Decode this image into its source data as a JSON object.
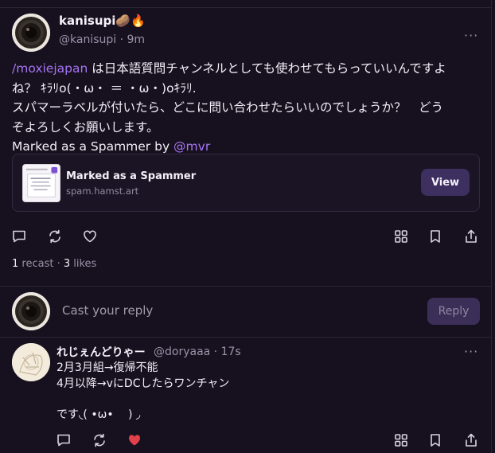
{
  "post": {
    "author_name": "kanisupi🥔🔥",
    "author_handle": "@kanisupi · 9m",
    "more_label": "···",
    "channel_mention": "/moxiejapan",
    "body_line1_rest": " は日本語質問チャンネルとしても使わせてもらっていいんですよ",
    "body_line2": "ね？ ｷﾗﾘo(・ω・ ＝ ・ω・)oｷﾗﾘ.",
    "body_line3": "スパマーラベルが付いたら、どこに問い合わせたらいいのでしょうか？　どう",
    "body_line4": "ぞよろしくお願いします。",
    "body_line5_prefix": "Marked as a Spammer by ",
    "body_line5_mention": "@mvr",
    "embed": {
      "title": "Marked as a Spammer",
      "domain": "spam.hamst.art",
      "button_label": "View"
    },
    "actions": {
      "comment_icon": "comment-icon",
      "recast_icon": "recast-icon",
      "like_icon": "heart-icon",
      "grid_icon": "grid-icon",
      "bookmark_icon": "bookmark-icon",
      "share_icon": "share-icon"
    },
    "stats": {
      "recast_count": "1",
      "recast_label": " recast · ",
      "likes_count": "3",
      "likes_label": " likes"
    }
  },
  "reply_composer": {
    "placeholder": "Cast your reply",
    "button_label": "Reply"
  },
  "reply": {
    "author_name": "れじぇんどりゃー",
    "author_handle": "@doryaaa · 17s",
    "more_label": "···",
    "body": "2月3月組→復帰不能\n4月以降→vにDCしたらワンチャン\n\nです◟( •ω•　 ) ◞",
    "liked": true
  },
  "colors": {
    "background": "#17101f",
    "accent_mention": "#a675f2",
    "button_bg": "#3d3060",
    "like_red": "#e2404a"
  }
}
